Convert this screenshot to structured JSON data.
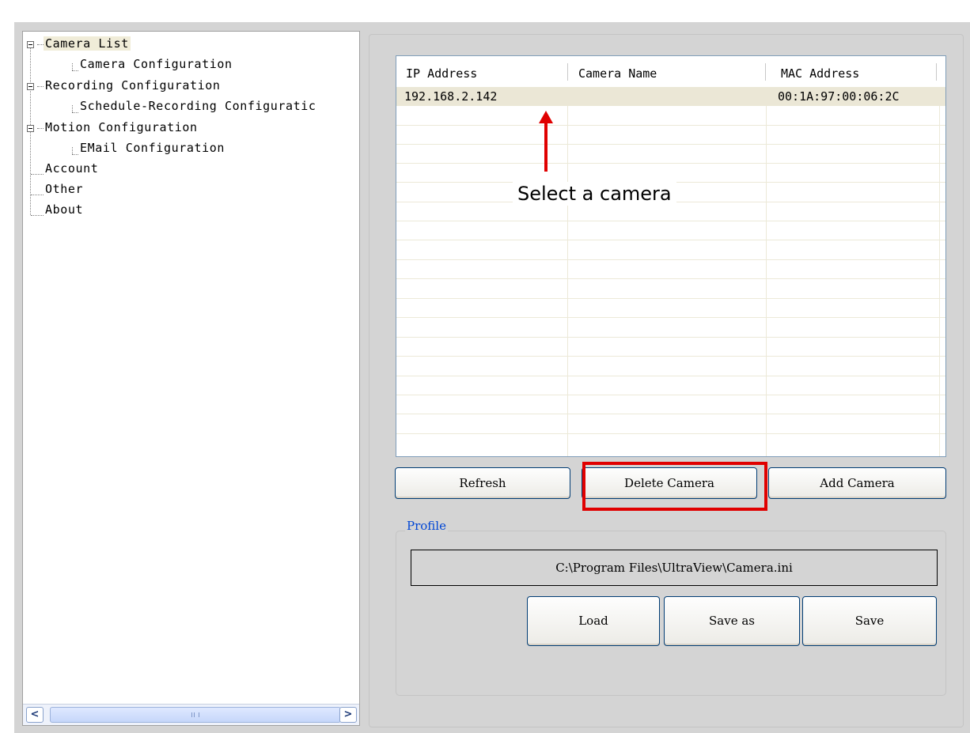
{
  "tree": {
    "items": [
      {
        "label": "Camera List"
      },
      {
        "label": "Camera Configuration"
      },
      {
        "label": "Recording Configuration"
      },
      {
        "label": "Schedule-Recording Configuratic"
      },
      {
        "label": "Motion Configuration"
      },
      {
        "label": "EMail Configuration"
      },
      {
        "label": "Account"
      },
      {
        "label": "Other"
      },
      {
        "label": "About"
      }
    ],
    "scroll": {
      "left": "<",
      "right": ">"
    }
  },
  "camera_table": {
    "columns": [
      "IP Address",
      "Camera Name",
      "MAC Address"
    ],
    "rows": [
      {
        "ip": "192.168.2.142",
        "name": "",
        "mac": "00:1A:97:00:06:2C"
      }
    ]
  },
  "annotation": {
    "text": "Select a camera",
    "color": "#e00000"
  },
  "buttons": {
    "refresh": "Refresh",
    "delete": "Delete Camera",
    "add": "Add Camera"
  },
  "profile": {
    "label": "Profile",
    "path": "C:\\Program Files\\UltraView\\Camera.ini",
    "load": "Load",
    "save_as": "Save as",
    "save": "Save"
  },
  "colors": {
    "panel_bg": "#d4d4d4",
    "selection": "#ebe7d6",
    "highlight": "#e00000",
    "group_label": "#0046d5"
  }
}
